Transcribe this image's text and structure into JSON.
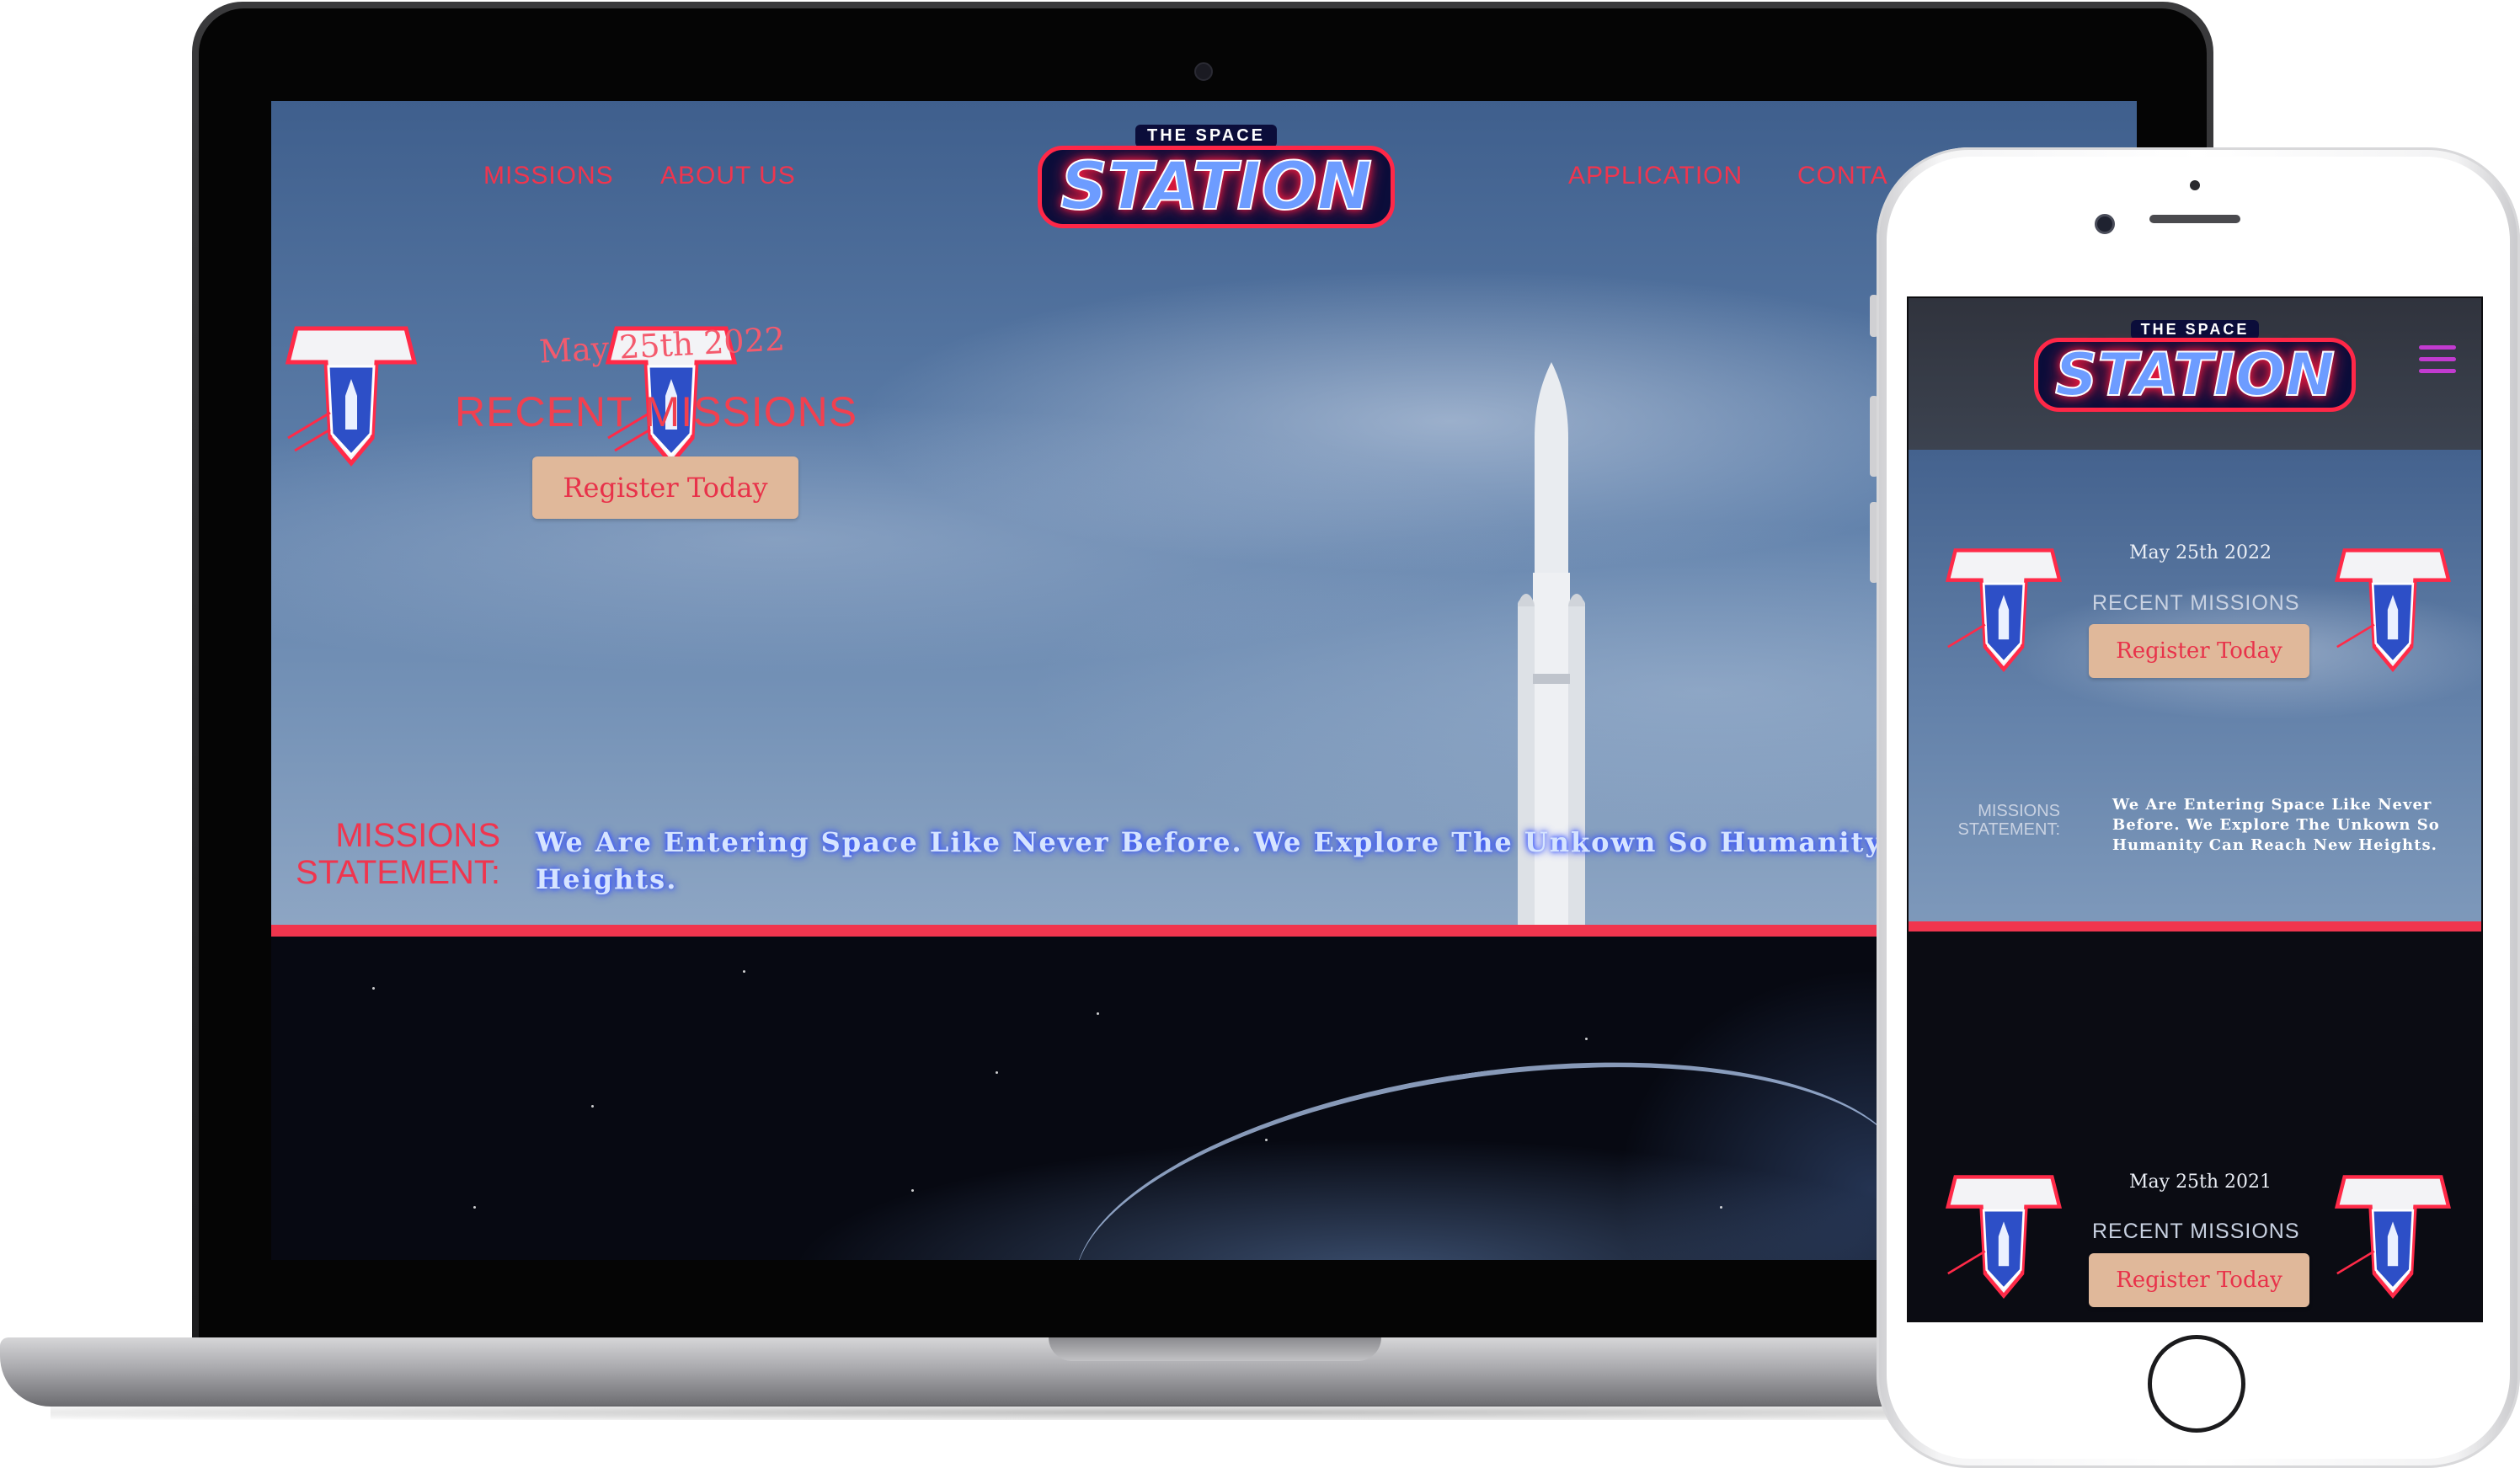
{
  "site": {
    "logo_small": "THE SPACE",
    "logo_big": "STATION"
  },
  "nav": {
    "missions": "MISSIONS",
    "about": "ABOUT US",
    "application": "APPLICATION",
    "contact": "CONTA"
  },
  "hero": {
    "date": "May 25th 2022",
    "title": "RECENT MISSIONS",
    "register": "Register Today"
  },
  "statement": {
    "label_line1": "MISSIONS",
    "label_line2": "STATEMENT:",
    "text_line1": "We Are Entering Space Like Never Before. We Explore The Unkown So Humanity Can",
    "text_line2": "Heights."
  },
  "mobile": {
    "date": "May 25th 2022",
    "title": "RECENT MISSIONS",
    "register": "Register Today",
    "statement_label_line1": "MISSIONS",
    "statement_label_line2": "STATEMENT:",
    "statement_line1": "We Are Entering Space Like Never",
    "statement_line2": "Before. We Explore The Unkown So",
    "statement_line3": "Humanity Can Reach New Heights.",
    "date2": "May 25th 2021",
    "title2": "RECENT MISSIONS",
    "register2": "Register Today"
  },
  "colors": {
    "accent_red": "#f0354e",
    "button_tan": "#e0b89a",
    "menu_purple": "#c23bd0"
  }
}
